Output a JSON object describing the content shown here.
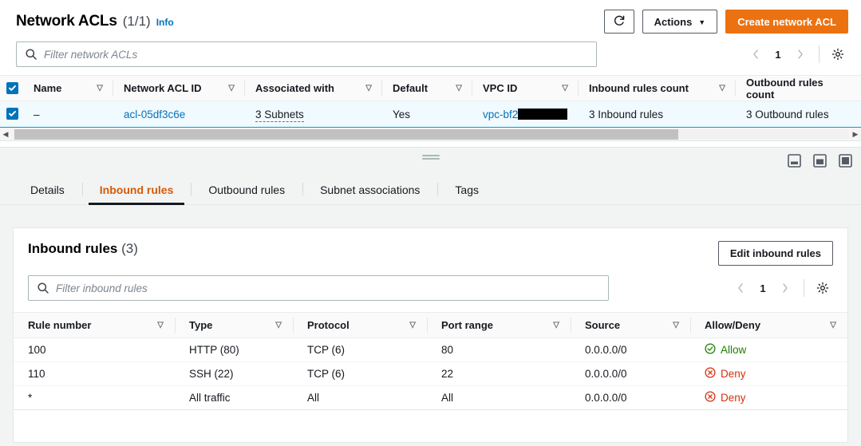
{
  "header": {
    "title": "Network ACLs",
    "count": "(1/1)",
    "info_label": "Info",
    "refresh_icon": "refresh-icon",
    "actions_label": "Actions",
    "create_label": "Create network ACL"
  },
  "list_filter": {
    "placeholder": "Filter network ACLs",
    "search_icon": "search-icon"
  },
  "list_pagination": {
    "prev": "‹",
    "page": "1",
    "next": "›",
    "settings_icon": "gear-icon"
  },
  "acl_table": {
    "columns": [
      "Name",
      "Network ACL ID",
      "Associated with",
      "Default",
      "VPC ID",
      "Inbound rules count",
      "Outbound rules count"
    ],
    "rows": [
      {
        "selected": true,
        "name": "–",
        "acl_id": "acl-05df3c6e",
        "associated_with": "3 Subnets",
        "default": "Yes",
        "vpc_id": "vpc-bf2",
        "vpc_id_redacted": true,
        "inbound_rules_count": "3 Inbound rules",
        "outbound_rules_count": "3 Outbound rules"
      }
    ]
  },
  "split_panel": {
    "drag_handle": "drag-handle",
    "size_icons": [
      "panel-size-small-icon",
      "panel-size-medium-icon",
      "panel-size-large-icon"
    ],
    "tabs": [
      {
        "label": "Details",
        "active": false
      },
      {
        "label": "Inbound rules",
        "active": true
      },
      {
        "label": "Outbound rules",
        "active": false
      },
      {
        "label": "Subnet associations",
        "active": false
      },
      {
        "label": "Tags",
        "active": false
      }
    ]
  },
  "inbound_panel": {
    "title": "Inbound rules",
    "count": "(3)",
    "edit_label": "Edit inbound rules",
    "filter_placeholder": "Filter inbound rules",
    "pagination": {
      "prev": "‹",
      "page": "1",
      "next": "›",
      "settings_icon": "gear-icon"
    },
    "columns": [
      "Rule number",
      "Type",
      "Protocol",
      "Port range",
      "Source",
      "Allow/Deny"
    ],
    "rows": [
      {
        "rule_number": "100",
        "type": "HTTP (80)",
        "protocol": "TCP (6)",
        "port_range": "80",
        "source": "0.0.0.0/0",
        "verdict": "Allow",
        "verdict_kind": "allow"
      },
      {
        "rule_number": "110",
        "type": "SSH (22)",
        "protocol": "TCP (6)",
        "port_range": "22",
        "source": "0.0.0.0/0",
        "verdict": "Deny",
        "verdict_kind": "deny"
      },
      {
        "rule_number": "*",
        "type": "All traffic",
        "protocol": "All",
        "port_range": "All",
        "source": "0.0.0.0/0",
        "verdict": "Deny",
        "verdict_kind": "deny"
      }
    ]
  },
  "colors": {
    "primary": "#ec7211",
    "link": "#0073bb",
    "allow": "#1d8102",
    "deny": "#d13212",
    "selection_border": "#00a1c9",
    "selection_bg": "#f1faff"
  }
}
